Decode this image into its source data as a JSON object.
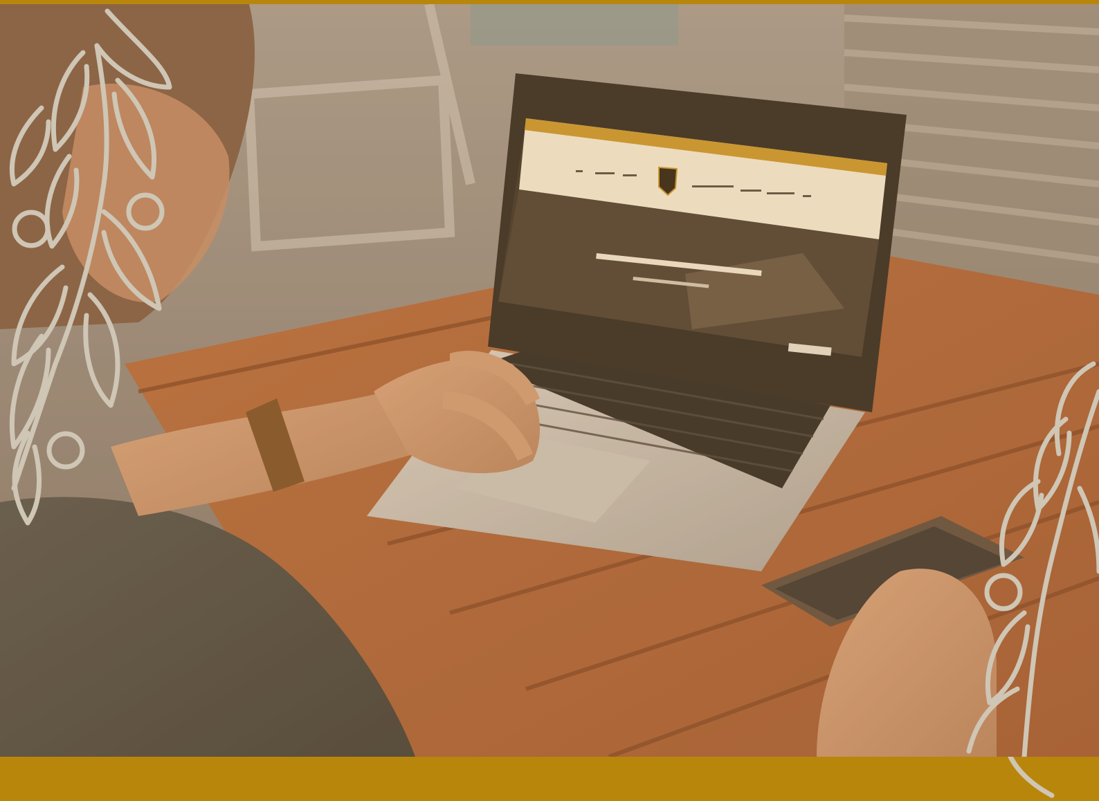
{
  "colors": {
    "accent_band": "#b8860b",
    "screen_header": "#f3ead6",
    "screen_header_stripe": "#c8952a",
    "leaf_outline": "#cfc6b5",
    "table_wood": "#b8683a"
  },
  "icons": {
    "leaf_ornament_left": "laurel-branch-icon",
    "leaf_ornament_right": "laurel-branch-icon",
    "screen_logo": "shield-crest-icon"
  },
  "screen": {
    "nav_left": [
      "...",
      "...",
      "..."
    ],
    "nav_right": [
      "...",
      "...",
      "...",
      "..."
    ],
    "hero_title": "",
    "hero_subtitle": ""
  }
}
